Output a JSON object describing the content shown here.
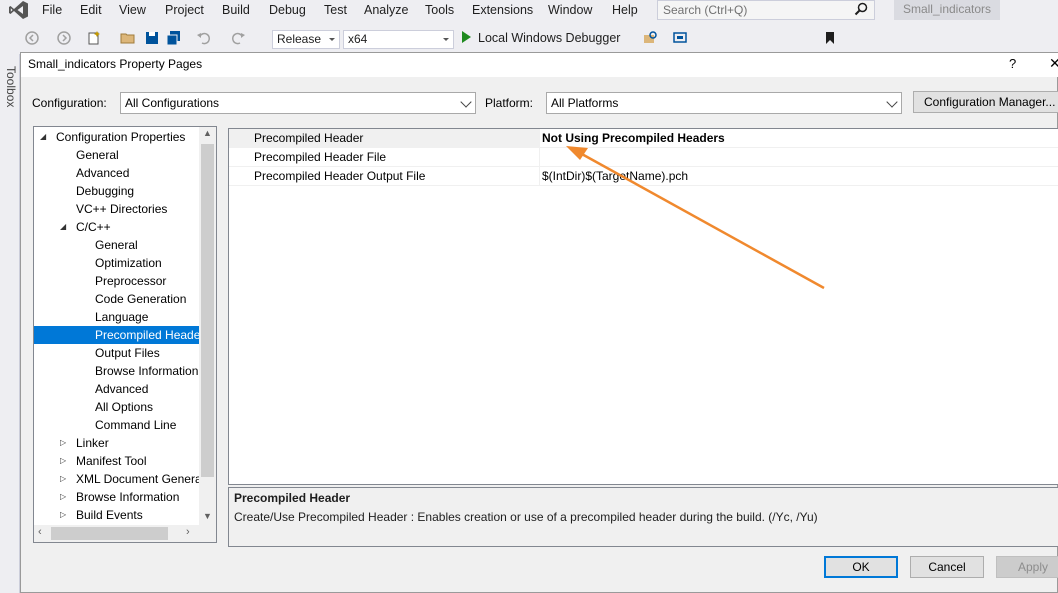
{
  "menubar": {
    "items": [
      "File",
      "Edit",
      "View",
      "Project",
      "Build",
      "Debug",
      "Test",
      "Analyze",
      "Tools",
      "Extensions",
      "Window",
      "Help"
    ],
    "search_placeholder": "Search (Ctrl+Q)",
    "solution_name": "Small_indicators"
  },
  "toolbar": {
    "configuration": "Release",
    "platform": "x64",
    "debugger": "Local Windows Debugger"
  },
  "toolbox": {
    "label": "Toolbox"
  },
  "dialog": {
    "title": "Small_indicators Property Pages",
    "help": "?",
    "close": "✕",
    "configuration_label": "Configuration:",
    "configuration_value": "All Configurations",
    "platform_label": "Platform:",
    "platform_value": "All Platforms",
    "config_manager": "Configuration Manager...",
    "tree": [
      {
        "label": "Configuration Properties",
        "level": 0,
        "glyph": "◢"
      },
      {
        "label": "General",
        "level": 1,
        "glyph": ""
      },
      {
        "label": "Advanced",
        "level": 1,
        "glyph": ""
      },
      {
        "label": "Debugging",
        "level": 1,
        "glyph": ""
      },
      {
        "label": "VC++ Directories",
        "level": 1,
        "glyph": ""
      },
      {
        "label": "C/C++",
        "level": 1,
        "glyph": "◢"
      },
      {
        "label": "General",
        "level": 2,
        "glyph": ""
      },
      {
        "label": "Optimization",
        "level": 2,
        "glyph": ""
      },
      {
        "label": "Preprocessor",
        "level": 2,
        "glyph": ""
      },
      {
        "label": "Code Generation",
        "level": 2,
        "glyph": ""
      },
      {
        "label": "Language",
        "level": 2,
        "glyph": ""
      },
      {
        "label": "Precompiled Heade",
        "level": 2,
        "glyph": "",
        "selected": true
      },
      {
        "label": "Output Files",
        "level": 2,
        "glyph": ""
      },
      {
        "label": "Browse Information",
        "level": 2,
        "glyph": ""
      },
      {
        "label": "Advanced",
        "level": 2,
        "glyph": ""
      },
      {
        "label": "All Options",
        "level": 2,
        "glyph": ""
      },
      {
        "label": "Command Line",
        "level": 2,
        "glyph": ""
      },
      {
        "label": "Linker",
        "level": 1,
        "glyph": "▷"
      },
      {
        "label": "Manifest Tool",
        "level": 1,
        "glyph": "▷"
      },
      {
        "label": "XML Document Genera",
        "level": 1,
        "glyph": "▷"
      },
      {
        "label": "Browse Information",
        "level": 1,
        "glyph": "▷"
      },
      {
        "label": "Build Events",
        "level": 1,
        "glyph": "▷"
      }
    ],
    "grid": [
      {
        "name": "Precompiled Header",
        "value": "Not Using Precompiled Headers",
        "bold": true,
        "selected": true
      },
      {
        "name": "Precompiled Header File",
        "value": "",
        "bold": false
      },
      {
        "name": "Precompiled Header Output File",
        "value": "$(IntDir)$(TargetName).pch",
        "bold": false
      }
    ],
    "description": {
      "title": "Precompiled Header",
      "text": "Create/Use Precompiled Header : Enables creation or use of a precompiled header during the build.     (/Yc, /Yu)"
    },
    "buttons": {
      "ok": "OK",
      "cancel": "Cancel",
      "apply": "Apply"
    }
  },
  "colors": {
    "selection": "#0078d7",
    "annotation_arrow": "#f0892e",
    "play": "#1f8a1f"
  }
}
